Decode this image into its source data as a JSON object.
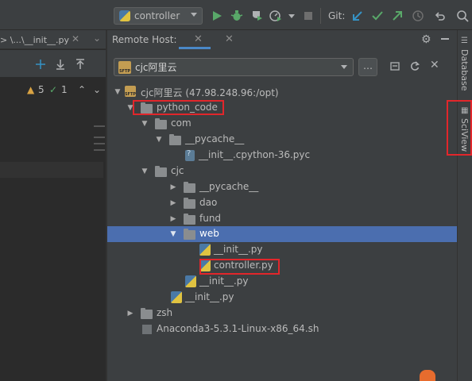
{
  "toolbar": {
    "run_config": "controller",
    "git_label": "Git:"
  },
  "editor": {
    "tab_label": "> \\...\\__init__.py",
    "warnings": "5",
    "checks": "1"
  },
  "panel": {
    "title": "Remote Host:",
    "host": "cjc阿里云"
  },
  "tree": [
    {
      "label": "cjc阿里云 (47.98.248.96:/opt)",
      "kind": "sftp",
      "depth": 0,
      "arrow": "down"
    },
    {
      "label": "python_code",
      "kind": "folder",
      "depth": 1,
      "arrow": "down"
    },
    {
      "label": "com",
      "kind": "folder",
      "depth": 2,
      "arrow": "down"
    },
    {
      "label": "__pycache__",
      "kind": "folder",
      "depth": 3,
      "arrow": "down"
    },
    {
      "label": "__init__.cpython-36.pyc",
      "kind": "cfile",
      "depth": 4,
      "arrow": ""
    },
    {
      "label": "cjc",
      "kind": "folder",
      "depth": 2,
      "arrow": "down"
    },
    {
      "label": "__pycache__",
      "kind": "folder",
      "depth": 3,
      "arrow": "right"
    },
    {
      "label": "dao",
      "kind": "folder",
      "depth": 3,
      "arrow": "right"
    },
    {
      "label": "fund",
      "kind": "folder",
      "depth": 3,
      "arrow": "right"
    },
    {
      "label": "web",
      "kind": "folder",
      "depth": 3,
      "arrow": "down",
      "selected": true
    },
    {
      "label": "__init__.py",
      "kind": "py",
      "depth": 4,
      "arrow": ""
    },
    {
      "label": "controller.py",
      "kind": "py",
      "depth": 4,
      "arrow": ""
    },
    {
      "label": "__init__.py",
      "kind": "py",
      "depth": 3,
      "arrow": ""
    },
    {
      "label": "__init__.py",
      "kind": "py",
      "depth": 2,
      "arrow": ""
    },
    {
      "label": "zsh",
      "kind": "folder",
      "depth": 1,
      "arrow": "right"
    },
    {
      "label": "Anaconda3-5.3.1-Linux-x86_64.sh",
      "kind": "sh",
      "depth": 1,
      "arrow": ""
    }
  ],
  "right_strip": {
    "database": "Database",
    "sciview": "SciView"
  },
  "colors": {
    "selection": "#4b6eaf",
    "highlight_box": "#e2262b",
    "accent": "#4a88c7"
  }
}
